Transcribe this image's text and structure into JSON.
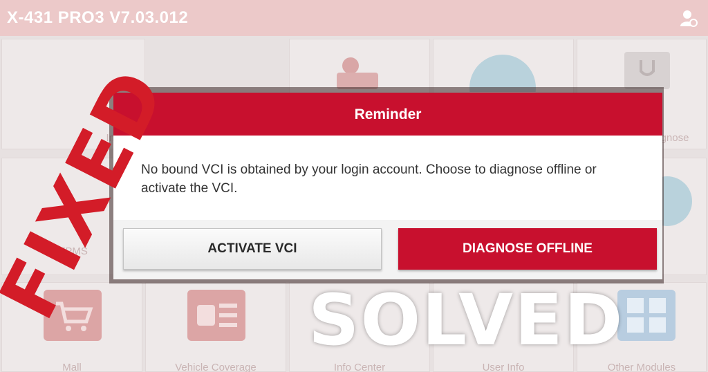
{
  "app": {
    "title": "X-431 PRO3 V7.03.012"
  },
  "modules": {
    "row1": [
      "",
      "",
      "",
      "",
      "Diagnose"
    ],
    "row1_partial": [
      "Inte",
      "",
      "",
      "",
      "gnose"
    ],
    "row2": [
      "TPMS"
    ],
    "row3": [
      "Mall",
      "Vehicle Coverage",
      "Info Center",
      "User Info",
      "Other Modules"
    ]
  },
  "dialog": {
    "title": "Reminder",
    "message": "No bound VCI is obtained by your login account. Choose to diagnose offline or activate the VCI.",
    "activate_label": "ACTIVATE VCI",
    "diagnose_label": "DIAGNOSE OFFLINE"
  },
  "overlay": {
    "fixed": "FIXED",
    "solved": "SOLVED"
  },
  "colors": {
    "brand_red": "#c8102e",
    "overlay_red": "#d31c28"
  },
  "icons": [
    "user-settings-icon",
    "technician-icon",
    "update-icon",
    "obd-port-icon",
    "cart-icon",
    "vehicle-coverage-icon",
    "other-modules-icon"
  ]
}
